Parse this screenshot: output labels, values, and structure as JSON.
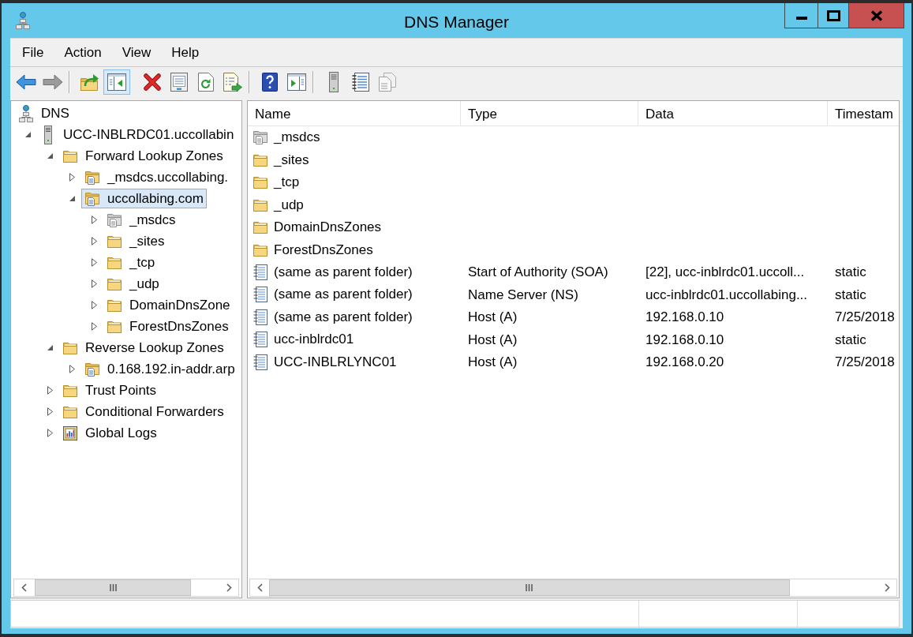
{
  "window": {
    "title": "DNS Manager"
  },
  "menu": [
    {
      "label": "File"
    },
    {
      "label": "Action"
    },
    {
      "label": "View"
    },
    {
      "label": "Help"
    }
  ],
  "toolbar": [
    {
      "separator": false,
      "buttons": [
        {
          "kind": "back",
          "pressed": false,
          "disabled": false
        },
        {
          "kind": "forward",
          "pressed": false,
          "disabled": true
        }
      ]
    },
    {
      "separator": true,
      "buttons": [
        {
          "kind": "up",
          "pressed": false,
          "disabled": false
        },
        {
          "kind": "console_tree",
          "pressed": true,
          "disabled": false
        }
      ]
    },
    {
      "separator": false,
      "buttons": [
        {
          "kind": "delete",
          "pressed": false,
          "disabled": false
        },
        {
          "kind": "properties",
          "pressed": false,
          "disabled": false
        },
        {
          "kind": "refresh",
          "pressed": false,
          "disabled": false
        },
        {
          "kind": "export",
          "pressed": false,
          "disabled": false
        }
      ]
    },
    {
      "separator": true,
      "buttons": [
        {
          "kind": "help",
          "pressed": false,
          "disabled": false
        },
        {
          "kind": "action_pane",
          "pressed": false,
          "disabled": false
        }
      ]
    },
    {
      "separator": true,
      "buttons": [
        {
          "kind": "server",
          "pressed": false,
          "disabled": false
        },
        {
          "kind": "list",
          "pressed": false,
          "disabled": false
        },
        {
          "kind": "copy",
          "pressed": false,
          "disabled": true
        }
      ]
    }
  ],
  "tree": {
    "label": "DNS",
    "kind": "dns",
    "selected": false,
    "children": [
      {
        "label": "UCC-INBLRDC01.uccollabin",
        "kind": "server",
        "expanded": true,
        "selected": false,
        "children": [
          {
            "label": "Forward Lookup Zones",
            "kind": "folder",
            "expanded": true,
            "selected": false,
            "children": [
              {
                "label": "_msdcs.uccollabing.",
                "kind": "zone",
                "expanded": false,
                "selected": false
              },
              {
                "label": "uccollabing.com",
                "kind": "zone",
                "expanded": true,
                "selected": true,
                "children": [
                  {
                    "label": "_msdcs",
                    "kind": "delegation",
                    "expanded": false,
                    "selected": false
                  },
                  {
                    "label": "_sites",
                    "kind": "folder",
                    "expanded": false,
                    "selected": false
                  },
                  {
                    "label": "_tcp",
                    "kind": "folder",
                    "expanded": false,
                    "selected": false
                  },
                  {
                    "label": "_udp",
                    "kind": "folder",
                    "expanded": false,
                    "selected": false
                  },
                  {
                    "label": "DomainDnsZone",
                    "kind": "folder",
                    "expanded": false,
                    "selected": false
                  },
                  {
                    "label": "ForestDnsZones",
                    "kind": "folder",
                    "expanded": false,
                    "selected": false
                  }
                ]
              }
            ]
          },
          {
            "label": "Reverse Lookup Zones",
            "kind": "folder",
            "expanded": true,
            "selected": false,
            "children": [
              {
                "label": "0.168.192.in-addr.arp",
                "kind": "zone",
                "expanded": false,
                "selected": false
              }
            ]
          },
          {
            "label": "Trust Points",
            "kind": "folder",
            "expanded": false,
            "selected": false
          },
          {
            "label": "Conditional Forwarders",
            "kind": "folder",
            "expanded": false,
            "selected": false
          },
          {
            "label": "Global Logs",
            "kind": "logs",
            "expanded": false,
            "selected": false
          }
        ]
      }
    ]
  },
  "list": {
    "columns": [
      "Name",
      "Type",
      "Data",
      "Timestam"
    ],
    "rows": [
      {
        "kind": "delegation",
        "selected": false,
        "cells": [
          "_msdcs"
        ]
      },
      {
        "kind": "folder",
        "selected": false,
        "cells": [
          "_sites"
        ]
      },
      {
        "kind": "folder",
        "selected": false,
        "cells": [
          "_tcp"
        ]
      },
      {
        "kind": "folder",
        "selected": false,
        "cells": [
          "_udp"
        ]
      },
      {
        "kind": "folder",
        "selected": false,
        "cells": [
          "DomainDnsZones"
        ]
      },
      {
        "kind": "folder",
        "selected": false,
        "cells": [
          "ForestDnsZones"
        ]
      },
      {
        "kind": "record",
        "selected": false,
        "cells": [
          "(same as parent folder)",
          "Start of Authority (SOA)",
          "[22], ucc-inblrdc01.uccoll...",
          "static"
        ]
      },
      {
        "kind": "record",
        "selected": false,
        "cells": [
          "(same as parent folder)",
          "Name Server (NS)",
          "ucc-inblrdc01.uccollabing...",
          "static"
        ]
      },
      {
        "kind": "record",
        "selected": false,
        "cells": [
          "(same as parent folder)",
          "Host (A)",
          "192.168.0.10",
          "7/25/2018"
        ]
      },
      {
        "kind": "record",
        "selected": false,
        "cells": [
          "ucc-inblrdc01",
          "Host (A)",
          "192.168.0.10",
          "static"
        ]
      },
      {
        "kind": "record",
        "selected": false,
        "cells": [
          "UCC-INBLRLYNC01",
          "Host (A)",
          "192.168.0.20",
          "7/25/2018"
        ]
      }
    ]
  }
}
